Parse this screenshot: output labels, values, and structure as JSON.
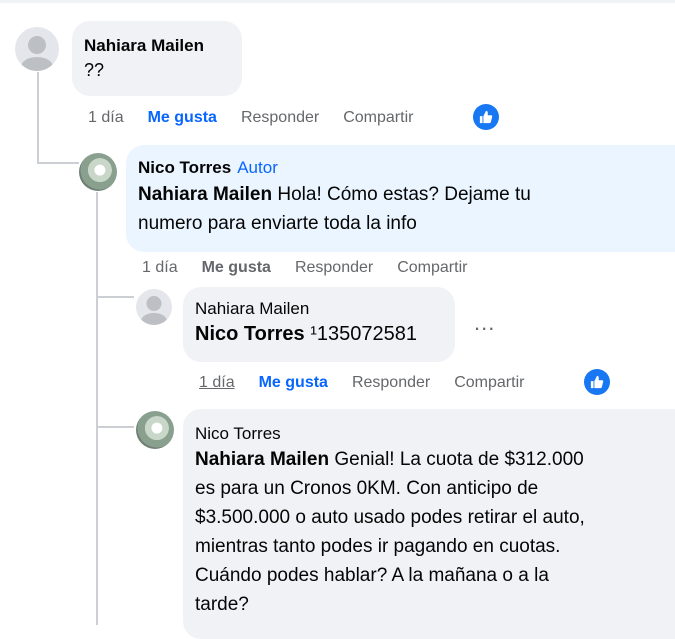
{
  "comments": [
    {
      "author": "Nahiara Mailen",
      "text": "??",
      "actions": {
        "time": "1 día",
        "like": "Me gusta",
        "reply": "Responder",
        "share": "Compartir"
      }
    },
    {
      "author": "Nico Torres",
      "author_tag": "Autor",
      "mention": "Nahiara Mailen",
      "text_line1": " Hola! Cómo estas? Dejame tu",
      "text_line2": "numero para enviarte toda la info",
      "actions": {
        "time": "1 día",
        "like": "Me gusta",
        "reply": "Responder",
        "share": "Compartir"
      }
    },
    {
      "author": "Nahiara Mailen",
      "mention": "Nico Torres",
      "text": " ¹135072581",
      "more": "...",
      "actions": {
        "time": "1 día",
        "like": "Me gusta",
        "reply": "Responder",
        "share": "Compartir"
      }
    },
    {
      "author": "Nico Torres",
      "mention": "Nahiara Mailen",
      "lines": [
        " Genial! La cuota de $312.000",
        "es para un Cronos 0KM. Con anticipo de",
        "$3.500.000 o auto usado podes retirar el auto,",
        "mientras tanto podes ir pagando en cuotas.",
        "Cuándo podes hablar? A la mañana o a la",
        "tarde?"
      ]
    }
  ],
  "colors": {
    "link_blue": "#0866ff",
    "bubble_grey": "#f0f2f5",
    "bubble_blue": "#ebf5ff",
    "meta_grey": "#65676b"
  },
  "icons": {
    "reaction": "like-thumb-icon",
    "more": "more-options-icon"
  }
}
